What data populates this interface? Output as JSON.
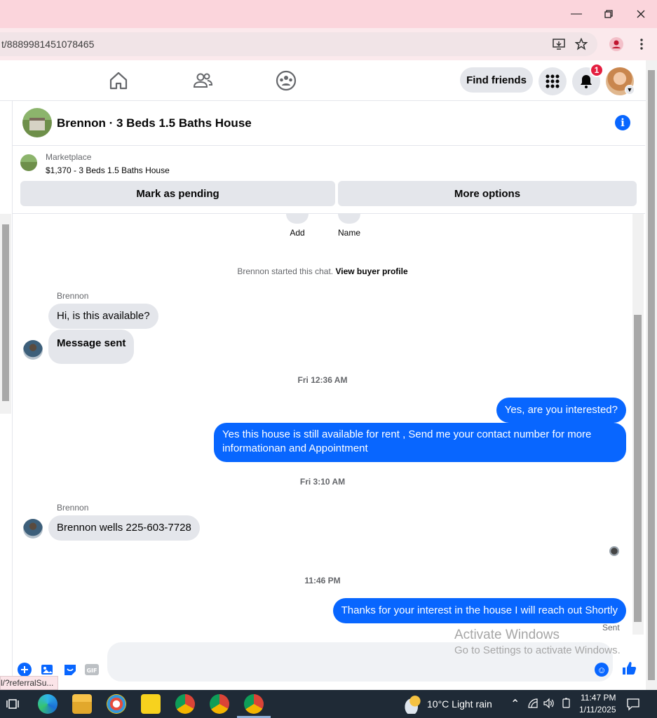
{
  "browser": {
    "url": "t/8889981451078465",
    "status_url": "l/?referralSu..."
  },
  "fbnav": {
    "find_friends": "Find friends",
    "notification_count": "1"
  },
  "chat": {
    "title": "Brennon · 3 Beds 1.5 Baths House",
    "listing_label": "Marketplace",
    "listing_price": "$1,370 - 3 Beds 1.5 Baths House",
    "mark_pending": "Mark as pending",
    "more_options": "More options",
    "quick_add": "Add",
    "quick_name": "Name",
    "system_prefix": "Brennon started this chat.",
    "system_link": "View buyer profile"
  },
  "messages": {
    "sender1": "Brennon",
    "m1": "Hi, is this available?",
    "m2": "Message sent",
    "stamp1": "Fri 12:36 AM",
    "m3": "Yes, are you interested?",
    "m4": "Yes this house is still available for rent , Send me your contact number for more informationan and Appointment",
    "stamp2": "Fri 3:10 AM",
    "sender2": "Brennon",
    "m5": "Brennon wells 225-603-7728",
    "stamp3": "11:46 PM",
    "m6": "Thanks for your interest in the house I will reach out Shortly",
    "sent": "Sent"
  },
  "watermark": {
    "line1": "Activate Windows",
    "line2": "Go to Settings to activate Windows."
  },
  "taskbar": {
    "weather": "10°C  Light rain",
    "time": "11:47 PM",
    "date": "1/11/2025"
  },
  "colors": {
    "fb_blue": "#0866ff",
    "bubble_gray": "#e4e6eb",
    "titlebar": "#fbd5dc",
    "badge_red": "#e41e3f"
  }
}
